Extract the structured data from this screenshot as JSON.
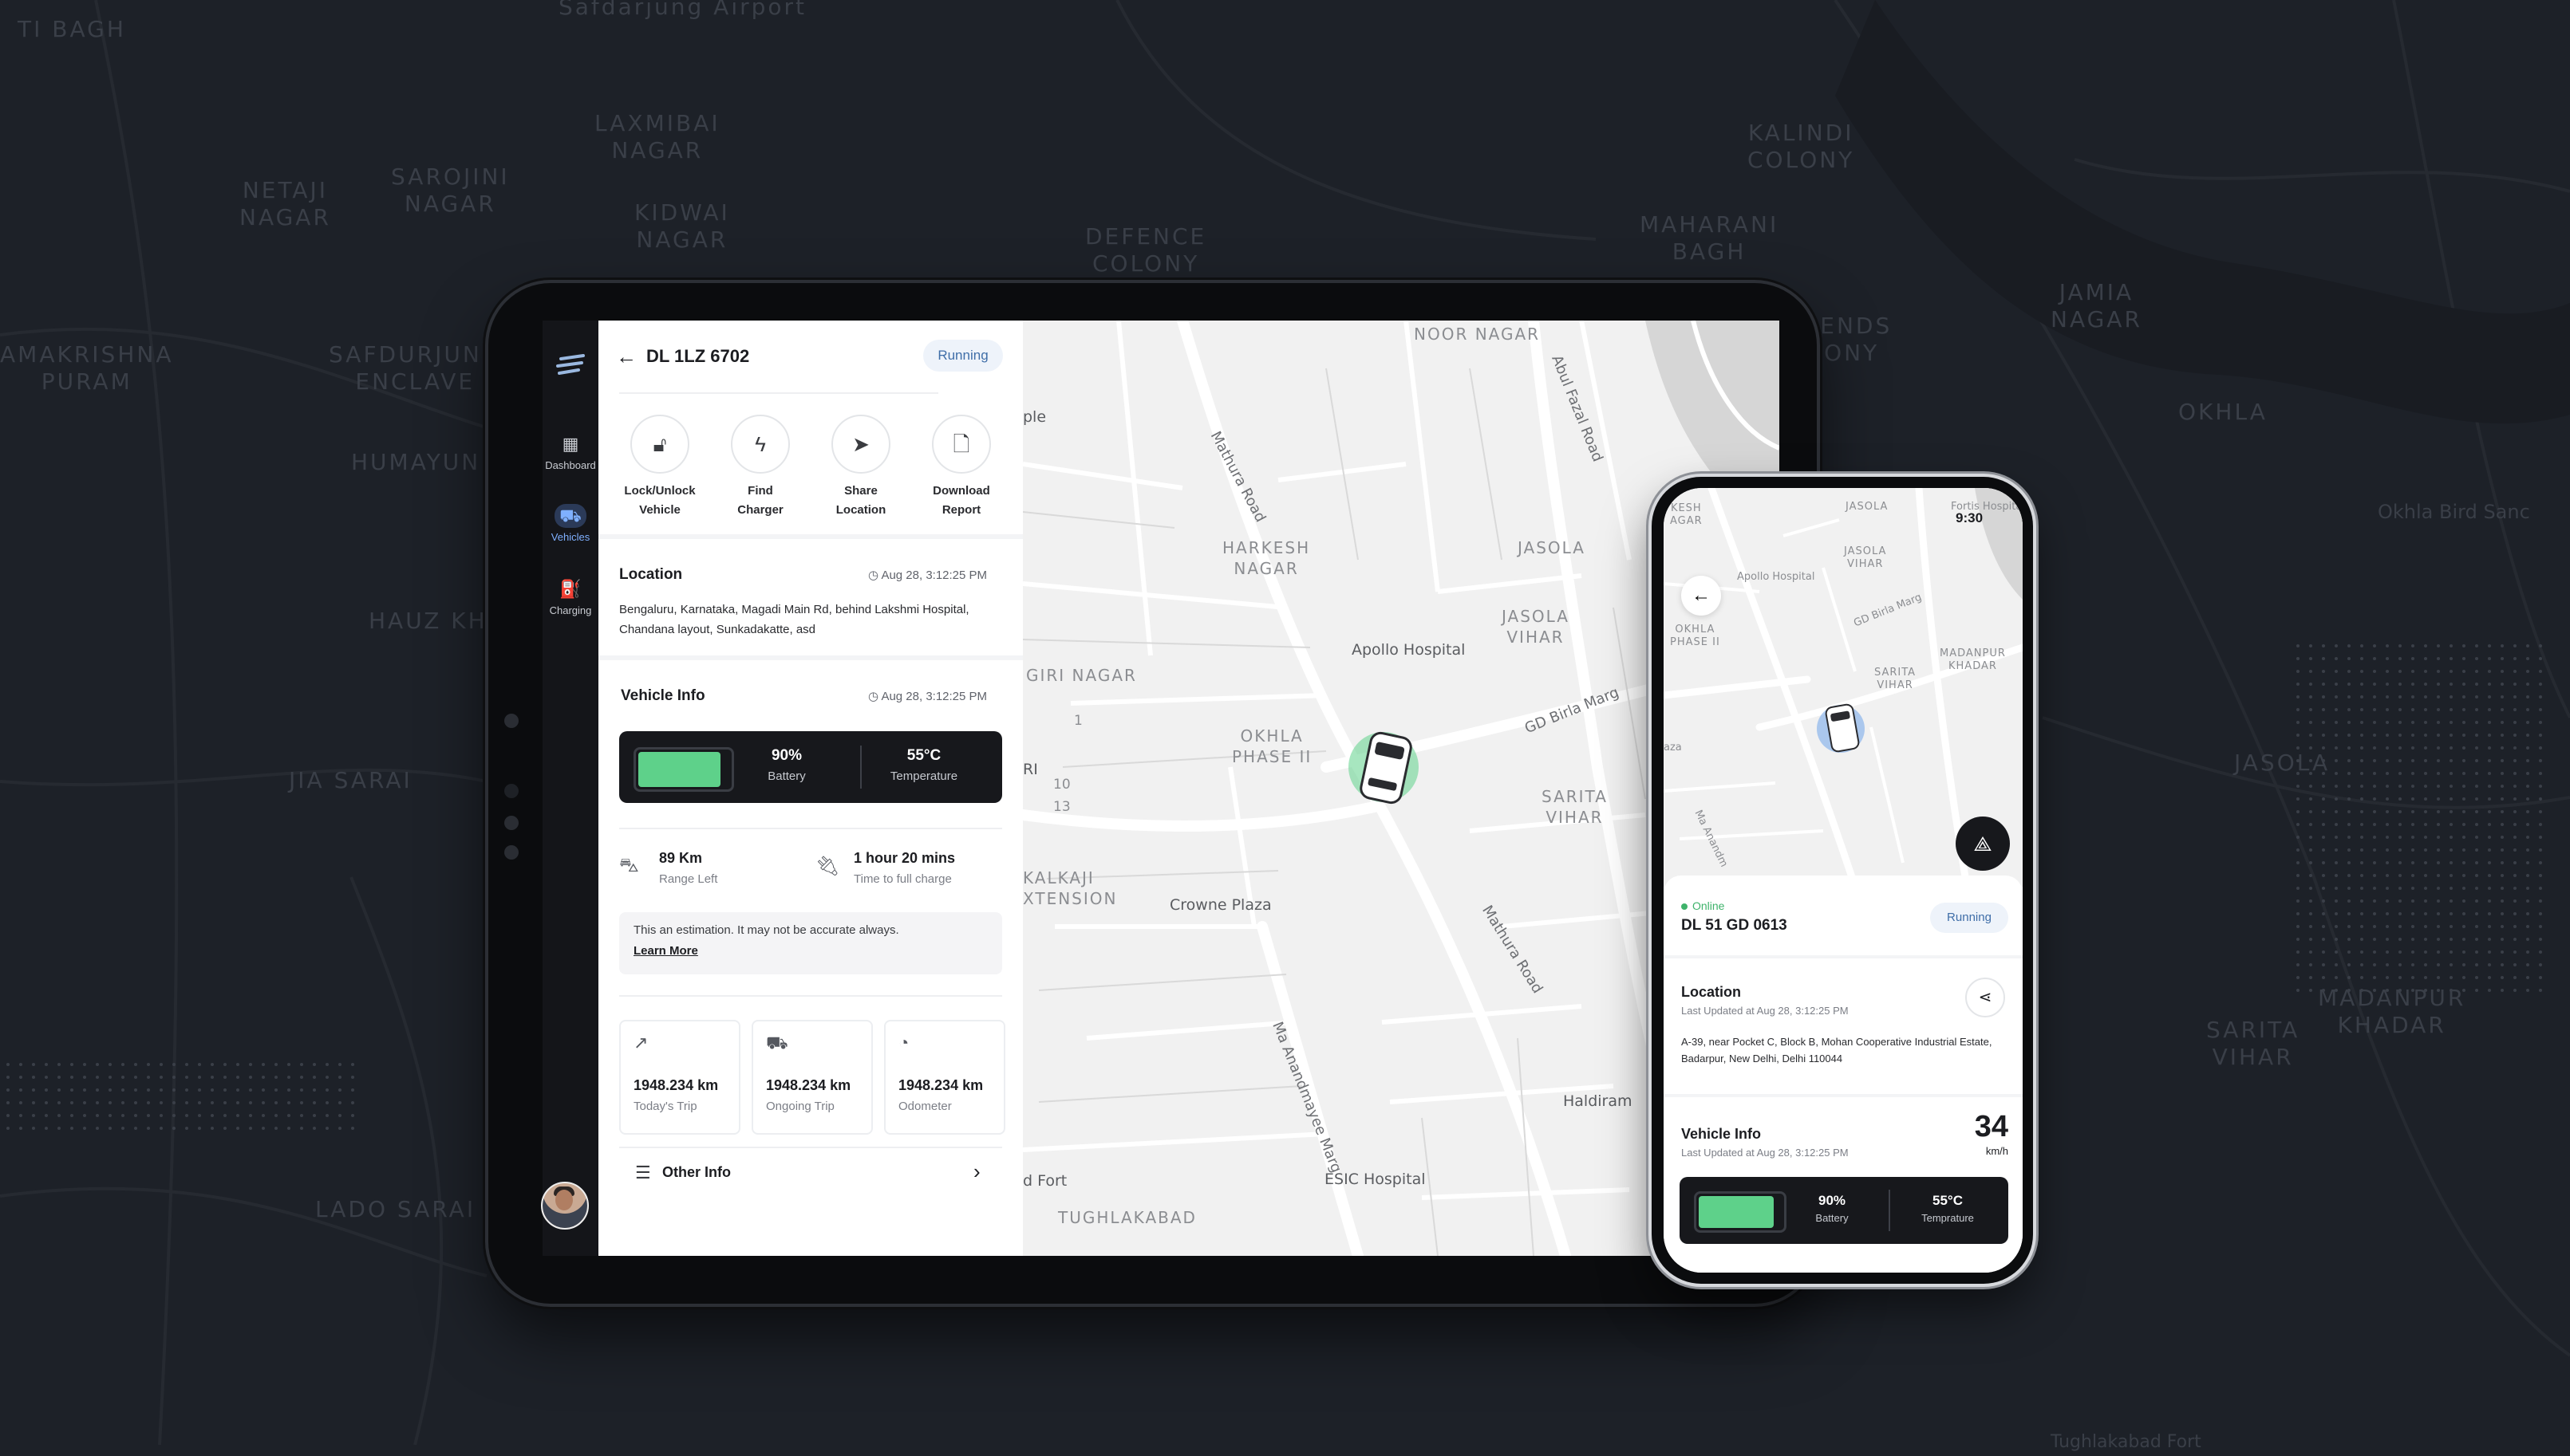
{
  "background_map": {
    "labels": [
      "Safdarjung Airport",
      "LAXMIBAI\nNAGAR",
      "KIDWAI\nNAGAR",
      "NETAJI\nNAGAR",
      "SAROJINI\nNAGAR",
      "DEFENCE\nCOLONY",
      "KALINDI\nCOLONY",
      "MAHARANI\nBAGH",
      "JAMIA\nNAGAR",
      "AMAKRISHNA\nPURAM",
      "SAFDURJUNG\nENCLAVE",
      "HUMAYUNPUR",
      "HAUZ KHAS",
      "JIA SARAI",
      "OKHLA",
      "JASOLA",
      "SARITA\nVIHAR",
      "MADANPUR\nKHADAR",
      "LADO SARAI",
      "Okhla Bird Sanc",
      "IENDS\nONY",
      "TI BAGH",
      "Tughlakabad Fort"
    ]
  },
  "sidebar": {
    "items": [
      {
        "label": "Dashboard",
        "icon": "dashboard-icon"
      },
      {
        "label": "Vehicles",
        "icon": "truck-icon"
      },
      {
        "label": "Charging",
        "icon": "charging-station-icon"
      }
    ]
  },
  "vehicle_panel": {
    "plate": "DL 1LZ 6702",
    "status": "Running",
    "actions": [
      {
        "label": "Lock/Unlock\nVehicle",
        "icon": "lock-icon"
      },
      {
        "label": "Find\nCharger",
        "icon": "bolt-icon"
      },
      {
        "label": "Share\nLocation",
        "icon": "navigation-arrow-icon"
      },
      {
        "label": "Download\nReport",
        "icon": "document-icon"
      }
    ],
    "location": {
      "title": "Location",
      "timestamp": "Aug 28, 3:12:25 PM",
      "address": "Bengaluru, Karnataka, Magadi Main Rd, behind Lakshmi Hospital, Chandana layout, Sunkadakatte,  asd"
    },
    "vehicle_info": {
      "title": "Vehicle Info",
      "timestamp": "Aug 28, 3:12:25 PM",
      "battery_value": "90%",
      "battery_label": "Battery",
      "battery_level": 0.9,
      "temp_value": "55°C",
      "temp_label": "Temperature"
    },
    "range": {
      "value": "89 Km",
      "label": "Range Left"
    },
    "charge_time": {
      "value": "1 hour 20 mins",
      "label": "Time to full charge"
    },
    "note": {
      "text": "This an estimation. It may not be accurate always.",
      "link": "Learn More"
    },
    "trips": [
      {
        "value": "1948.234 km",
        "label": "Today's Trip",
        "icon": "route-icon"
      },
      {
        "value": "1948.234 km",
        "label": "Ongoing Trip",
        "icon": "truck-icon"
      },
      {
        "value": "1948.234 km",
        "label": "Odometer",
        "icon": "speedometer-icon"
      }
    ],
    "other_info": "Other Info"
  },
  "map": {
    "areas": [
      "NOOR NAGAR",
      "HARKESH\nNAGAR",
      "JASOLA",
      "JASOLA\nVIHAR",
      "OKHLA\nPHASE II",
      "SARITA\nVIHAR",
      "GIRI NAGAR",
      "KALKAJI\nXTENSION",
      "TUGHLAKABAD"
    ],
    "pois": [
      "Apollo Hospital",
      "Crowne Plaza",
      "Haldiram",
      "ESIC Hospital",
      "d Fort",
      "ple",
      "RI"
    ],
    "roads": [
      "Mathura Road",
      "Abul Fazal Road",
      "GD Birla Marg",
      "Mathura Road",
      "Ma Anandmayee Marg"
    ],
    "numbers": [
      "1",
      "10",
      "13"
    ]
  },
  "phone": {
    "time": "9:30",
    "map_labels": [
      "KESH\nAGAR",
      "JASOLA",
      "Fortis Hospital",
      "Apollo Hospital",
      "JASOLA\nVIHAR",
      "GD Birla Marg",
      "OKHLA\nPHASE II",
      "SARITA\nVIHAR",
      "MADANPUR\nKHADAR",
      "aza",
      "Ma Anandm"
    ],
    "online": "Online",
    "plate": "DL 51 GD 0613",
    "status": "Running",
    "location_title": "Location",
    "location_updated": "Last Updated at Aug 28, 3:12:25 PM",
    "address": "A-39, near Pocket C, Block B, Mohan Cooperative Industrial Estate, Badarpur, New Delhi, Delhi 110044",
    "info_title": "Vehicle Info",
    "info_updated": "Last Updated at Aug 28, 3:12:25 PM",
    "speed": "34",
    "speed_unit": "km/h",
    "battery_value": "90%",
    "battery_label": "Battery",
    "battery_level": 0.9,
    "temp_value": "55°C",
    "temp_label": "Temprature"
  },
  "colors": {
    "accent": "#7fb0ff",
    "battery": "#5ed18a",
    "running": "#3f6ea8",
    "dark_card": "#17181c"
  }
}
